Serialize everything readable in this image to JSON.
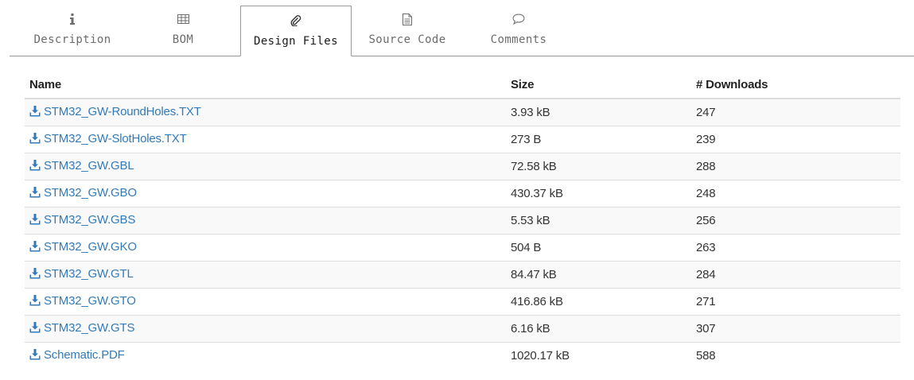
{
  "tabs": [
    {
      "label": "Description",
      "icon": "info-icon",
      "active": false
    },
    {
      "label": "BOM",
      "icon": "table-icon",
      "active": false
    },
    {
      "label": "Design Files",
      "icon": "paperclip-icon",
      "active": true
    },
    {
      "label": "Source Code",
      "icon": "document-icon",
      "active": false
    },
    {
      "label": "Comments",
      "icon": "speech-bubble-icon",
      "active": false
    }
  ],
  "table": {
    "headers": {
      "name": "Name",
      "size": "Size",
      "downloads": "# Downloads"
    },
    "rows": [
      {
        "name": "STM32_GW-RoundHoles.TXT",
        "size": "3.93 kB",
        "downloads": "247"
      },
      {
        "name": "STM32_GW-SlotHoles.TXT",
        "size": "273 B",
        "downloads": "239"
      },
      {
        "name": "STM32_GW.GBL",
        "size": "72.58 kB",
        "downloads": "288"
      },
      {
        "name": "STM32_GW.GBO",
        "size": "430.37 kB",
        "downloads": "248"
      },
      {
        "name": "STM32_GW.GBS",
        "size": "5.53 kB",
        "downloads": "256"
      },
      {
        "name": "STM32_GW.GKO",
        "size": "504 B",
        "downloads": "263"
      },
      {
        "name": "STM32_GW.GTL",
        "size": "84.47 kB",
        "downloads": "284"
      },
      {
        "name": "STM32_GW.GTO",
        "size": "416.86 kB",
        "downloads": "271"
      },
      {
        "name": "STM32_GW.GTS",
        "size": "6.16 kB",
        "downloads": "307"
      },
      {
        "name": "Schematic.PDF",
        "size": "1020.17 kB",
        "downloads": "588"
      }
    ]
  },
  "colors": {
    "link": "#337ab7",
    "border": "#dddddd",
    "stripe": "#f9f9f9",
    "tab_text": "#6c6c6c"
  }
}
